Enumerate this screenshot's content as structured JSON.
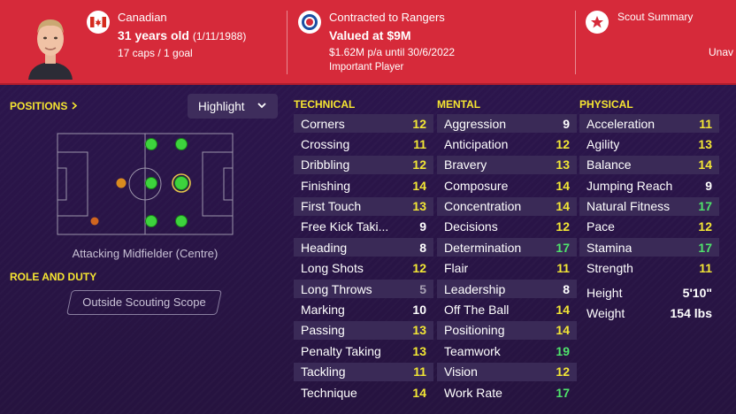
{
  "colors": {
    "header_bg": "#d62a3a",
    "section_title": "#f6e531",
    "val_white": "#ffffff",
    "val_yellow": "#f2e635",
    "val_green": "#4fe36b",
    "val_grey": "#a7a0b3"
  },
  "header": {
    "nationality": "Canadian",
    "age": "31 years old",
    "dob": "(1/11/1988)",
    "caps": "17 caps / 1 goal",
    "contract": "Contracted to Rangers",
    "value": "Valued at $9M",
    "wage": "$1.62M p/a until 30/6/2022",
    "status": "Important Player",
    "scout_title": "Scout Summary",
    "scout_text": "Unav",
    "icons": [
      "player-photo",
      "canada-flag-icon",
      "club-crest-icon",
      "star-icon"
    ]
  },
  "left_panel": {
    "positions_title": "POSITIONS",
    "positions_icon": "chevron-right-icon",
    "highlight_label": "Highlight",
    "highlight_icon": "chevron-down-icon",
    "position_name": "Attacking Midfielder (Centre)",
    "role_title": "ROLE AND DUTY",
    "scope_label": "Outside Scouting Scope"
  },
  "technical": {
    "title": "TECHNICAL",
    "attrs": [
      {
        "name": "Corners",
        "value": "12",
        "tier": "yellow"
      },
      {
        "name": "Crossing",
        "value": "11",
        "tier": "yellow"
      },
      {
        "name": "Dribbling",
        "value": "12",
        "tier": "yellow"
      },
      {
        "name": "Finishing",
        "value": "14",
        "tier": "yellow"
      },
      {
        "name": "First Touch",
        "value": "13",
        "tier": "yellow"
      },
      {
        "name": "Free Kick Taki...",
        "value": "9",
        "tier": "white"
      },
      {
        "name": "Heading",
        "value": "8",
        "tier": "white"
      },
      {
        "name": "Long Shots",
        "value": "12",
        "tier": "yellow"
      },
      {
        "name": "Long Throws",
        "value": "5",
        "tier": "grey"
      },
      {
        "name": "Marking",
        "value": "10",
        "tier": "white"
      },
      {
        "name": "Passing",
        "value": "13",
        "tier": "yellow"
      },
      {
        "name": "Penalty Taking",
        "value": "13",
        "tier": "yellow"
      },
      {
        "name": "Tackling",
        "value": "11",
        "tier": "yellow"
      },
      {
        "name": "Technique",
        "value": "14",
        "tier": "yellow"
      }
    ]
  },
  "mental": {
    "title": "MENTAL",
    "attrs": [
      {
        "name": "Aggression",
        "value": "9",
        "tier": "white"
      },
      {
        "name": "Anticipation",
        "value": "12",
        "tier": "yellow"
      },
      {
        "name": "Bravery",
        "value": "13",
        "tier": "yellow"
      },
      {
        "name": "Composure",
        "value": "14",
        "tier": "yellow"
      },
      {
        "name": "Concentration",
        "value": "14",
        "tier": "yellow"
      },
      {
        "name": "Decisions",
        "value": "12",
        "tier": "yellow"
      },
      {
        "name": "Determination",
        "value": "17",
        "tier": "green"
      },
      {
        "name": "Flair",
        "value": "11",
        "tier": "yellow"
      },
      {
        "name": "Leadership",
        "value": "8",
        "tier": "white"
      },
      {
        "name": "Off The Ball",
        "value": "14",
        "tier": "yellow"
      },
      {
        "name": "Positioning",
        "value": "14",
        "tier": "yellow"
      },
      {
        "name": "Teamwork",
        "value": "19",
        "tier": "green"
      },
      {
        "name": "Vision",
        "value": "12",
        "tier": "yellow"
      },
      {
        "name": "Work Rate",
        "value": "17",
        "tier": "green"
      }
    ]
  },
  "physical": {
    "title": "PHYSICAL",
    "attrs": [
      {
        "name": "Acceleration",
        "value": "11",
        "tier": "yellow"
      },
      {
        "name": "Agility",
        "value": "13",
        "tier": "yellow"
      },
      {
        "name": "Balance",
        "value": "14",
        "tier": "yellow"
      },
      {
        "name": "Jumping Reach",
        "value": "9",
        "tier": "white"
      },
      {
        "name": "Natural Fitness",
        "value": "17",
        "tier": "green"
      },
      {
        "name": "Pace",
        "value": "12",
        "tier": "yellow"
      },
      {
        "name": "Stamina",
        "value": "17",
        "tier": "green"
      },
      {
        "name": "Strength",
        "value": "11",
        "tier": "yellow"
      }
    ],
    "height_label": "Height",
    "height_value": "5'10\"",
    "weight_label": "Weight",
    "weight_value": "154 lbs"
  }
}
